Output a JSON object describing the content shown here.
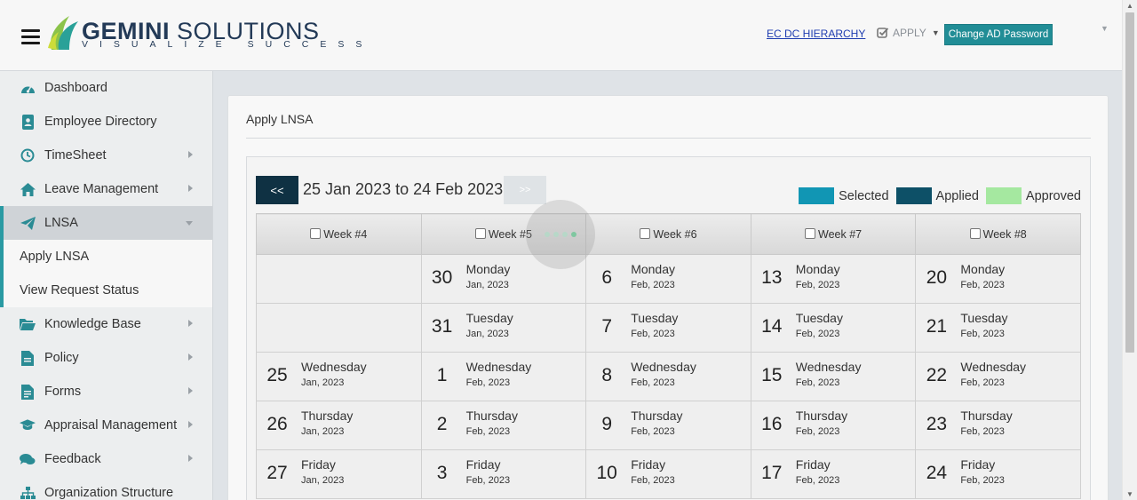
{
  "header": {
    "brand_name_bold": "GEMINI",
    "brand_name_rest": " SOLUTIONS",
    "brand_tagline": "VISUALIZE SUCCESS",
    "hierarchy_link": "EC DC HIERARCHY",
    "apply_label": "APPLY",
    "change_password_label": "Change AD Password"
  },
  "sidebar": {
    "items": [
      {
        "label": "Dashboard",
        "icon": "dashboard-icon"
      },
      {
        "label": "Employee Directory",
        "icon": "contacts-book-icon"
      },
      {
        "label": "TimeSheet",
        "icon": "clock-icon"
      },
      {
        "label": "Leave Management",
        "icon": "home-icon"
      },
      {
        "label": "LNSA",
        "icon": "paper-plane-icon"
      },
      {
        "label": "Knowledge Base",
        "icon": "folder-open-icon"
      },
      {
        "label": "Policy",
        "icon": "document-icon"
      },
      {
        "label": "Forms",
        "icon": "form-icon"
      },
      {
        "label": "Appraisal Management",
        "icon": "graduation-cap-icon"
      },
      {
        "label": "Feedback",
        "icon": "chat-bubbles-icon"
      },
      {
        "label": "Organization Structure",
        "icon": "org-chart-icon"
      }
    ],
    "lnsa_sub": [
      "Apply LNSA",
      "View Request Status"
    ]
  },
  "main": {
    "title": "Apply LNSA",
    "prev_label": "<<",
    "next_label": ">>",
    "date_range": "25 Jan 2023 to 24 Feb 2023",
    "legend": [
      {
        "label": "Selected",
        "color": "#1196b4"
      },
      {
        "label": "Applied",
        "color": "#0d5067"
      },
      {
        "label": "Approved",
        "color": "#a5e8a0"
      }
    ],
    "weeks": [
      "Week #4",
      "Week #5",
      "Week #6",
      "Week #7",
      "Week #8"
    ],
    "rows": [
      [
        null,
        {
          "num": "30",
          "day": "Monday",
          "month": "Jan, 2023"
        },
        {
          "num": "6",
          "day": "Monday",
          "month": "Feb, 2023"
        },
        {
          "num": "13",
          "day": "Monday",
          "month": "Feb, 2023"
        },
        {
          "num": "20",
          "day": "Monday",
          "month": "Feb, 2023"
        }
      ],
      [
        null,
        {
          "num": "31",
          "day": "Tuesday",
          "month": "Jan, 2023"
        },
        {
          "num": "7",
          "day": "Tuesday",
          "month": "Feb, 2023"
        },
        {
          "num": "14",
          "day": "Tuesday",
          "month": "Feb, 2023"
        },
        {
          "num": "21",
          "day": "Tuesday",
          "month": "Feb, 2023"
        }
      ],
      [
        {
          "num": "25",
          "day": "Wednesday",
          "month": "Jan, 2023"
        },
        {
          "num": "1",
          "day": "Wednesday",
          "month": "Feb, 2023"
        },
        {
          "num": "8",
          "day": "Wednesday",
          "month": "Feb, 2023"
        },
        {
          "num": "15",
          "day": "Wednesday",
          "month": "Feb, 2023"
        },
        {
          "num": "22",
          "day": "Wednesday",
          "month": "Feb, 2023"
        }
      ],
      [
        {
          "num": "26",
          "day": "Thursday",
          "month": "Jan, 2023"
        },
        {
          "num": "2",
          "day": "Thursday",
          "month": "Feb, 2023"
        },
        {
          "num": "9",
          "day": "Thursday",
          "month": "Feb, 2023"
        },
        {
          "num": "16",
          "day": "Thursday",
          "month": "Feb, 2023"
        },
        {
          "num": "23",
          "day": "Thursday",
          "month": "Feb, 2023"
        }
      ],
      [
        {
          "num": "27",
          "day": "Friday",
          "month": "Jan, 2023"
        },
        {
          "num": "3",
          "day": "Friday",
          "month": "Feb, 2023"
        },
        {
          "num": "10",
          "day": "Friday",
          "month": "Feb, 2023"
        },
        {
          "num": "17",
          "day": "Friday",
          "month": "Feb, 2023"
        },
        {
          "num": "24",
          "day": "Friday",
          "month": "Feb, 2023"
        }
      ]
    ]
  }
}
